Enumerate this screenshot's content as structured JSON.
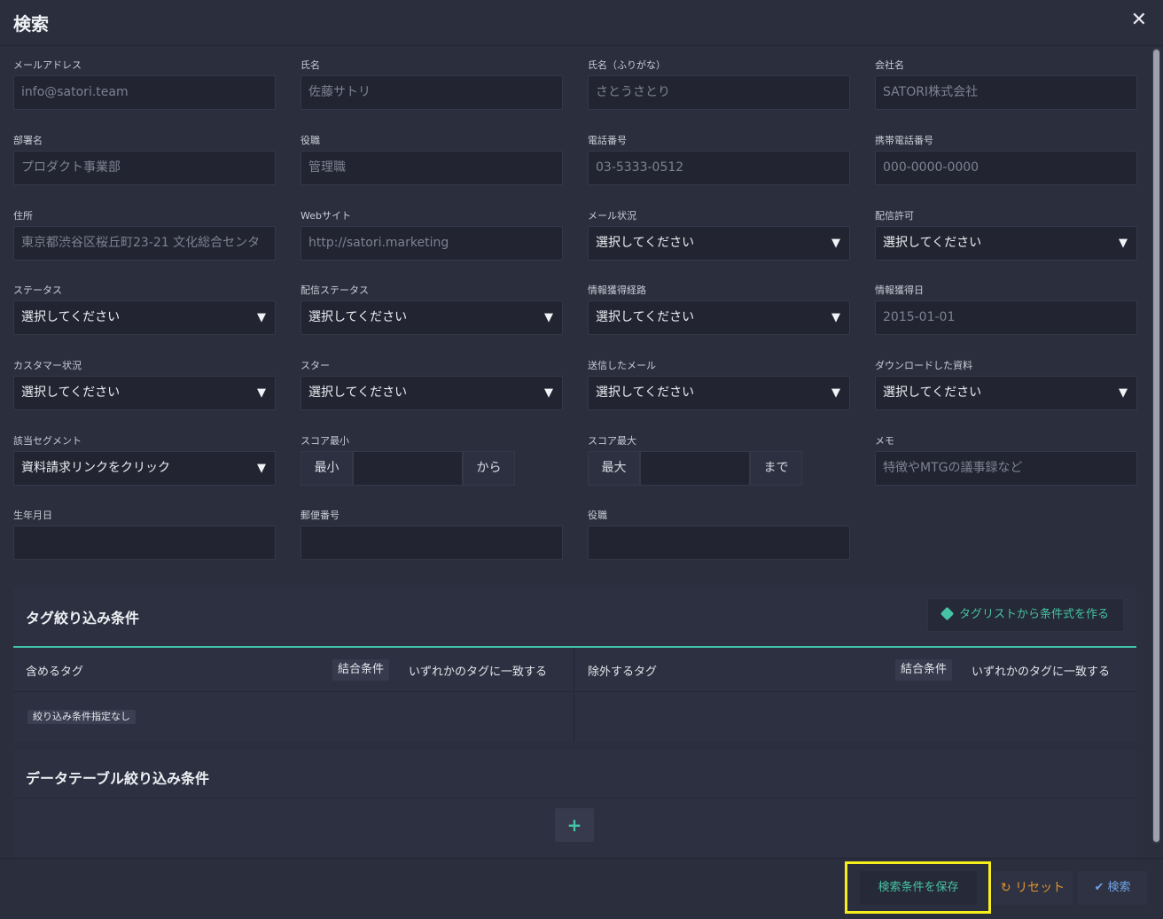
{
  "modal": {
    "title": "検索",
    "close": "✕"
  },
  "fields": {
    "email": {
      "label": "メールアドレス",
      "placeholder": "info@satori.team"
    },
    "name": {
      "label": "氏名",
      "placeholder": "佐藤サトリ"
    },
    "kana": {
      "label": "氏名（ふりがな）",
      "placeholder": "さとうさとり"
    },
    "company": {
      "label": "会社名",
      "placeholder": "SATORI株式会社"
    },
    "department": {
      "label": "部署名",
      "placeholder": "プロダクト事業部"
    },
    "position": {
      "label": "役職",
      "placeholder": "管理職"
    },
    "phone": {
      "label": "電話番号",
      "placeholder": "03-5333-0512"
    },
    "mobile": {
      "label": "携帯電話番号",
      "placeholder": "000-0000-0000"
    },
    "address": {
      "label": "住所",
      "placeholder": "東京都渋谷区桜丘町23-21 文化総合センタ"
    },
    "website": {
      "label": "Webサイト",
      "placeholder": "http://satori.marketing"
    },
    "mail_status": {
      "label": "メール状況",
      "value": "選択してください"
    },
    "delivery_permission": {
      "label": "配信許可",
      "value": "選択してください"
    },
    "status": {
      "label": "ステータス",
      "value": "選択してください"
    },
    "delivery_status": {
      "label": "配信ステータス",
      "value": "選択してください"
    },
    "acquisition_route": {
      "label": "情報獲得経路",
      "value": "選択してください"
    },
    "acquisition_date": {
      "label": "情報獲得日",
      "placeholder": "2015-01-01"
    },
    "customer_status": {
      "label": "カスタマー状況",
      "value": "選択してください"
    },
    "star": {
      "label": "スター",
      "value": "選択してください"
    },
    "sent_mail": {
      "label": "送信したメール",
      "value": "選択してください"
    },
    "downloaded": {
      "label": "ダウンロードした資料",
      "value": "選択してください"
    },
    "segment": {
      "label": "該当セグメント",
      "value": "資料請求リンクをクリック"
    },
    "score_min": {
      "label": "スコア最小",
      "prefix": "最小",
      "suffix": "から"
    },
    "score_max": {
      "label": "スコア最大",
      "prefix": "最大",
      "suffix": "まで"
    },
    "memo": {
      "label": "メモ",
      "placeholder": "特徴やMTGの議事録など"
    },
    "birthday": {
      "label": "生年月日"
    },
    "postal": {
      "label": "郵便番号"
    },
    "position2": {
      "label": "役職"
    }
  },
  "tag_panel": {
    "title": "タグ絞り込み条件",
    "button": "タグリストから条件式を作る",
    "include": {
      "label": "含めるタグ",
      "cond_label": "結合条件",
      "cond_value": "いずれかのタグに一致する",
      "empty": "絞り込み条件指定なし"
    },
    "exclude": {
      "label": "除外するタグ",
      "cond_label": "結合条件",
      "cond_value": "いずれかのタグに一致する"
    }
  },
  "datatable_panel": {
    "title": "データテーブル絞り込み条件",
    "add": "+"
  },
  "footer": {
    "save": "検索条件を保存",
    "reset": "リセット",
    "search": "検索"
  },
  "icons": {
    "close": "close-icon",
    "caret": "caret-down-icon",
    "tag": "tag-icon",
    "reset": "refresh-icon",
    "search": "check-icon"
  },
  "colors": {
    "accent_teal": "#3fc2a5",
    "reset_orange": "#e0932f",
    "search_blue": "#6fa4e6",
    "highlight": "#f7ee1c"
  }
}
